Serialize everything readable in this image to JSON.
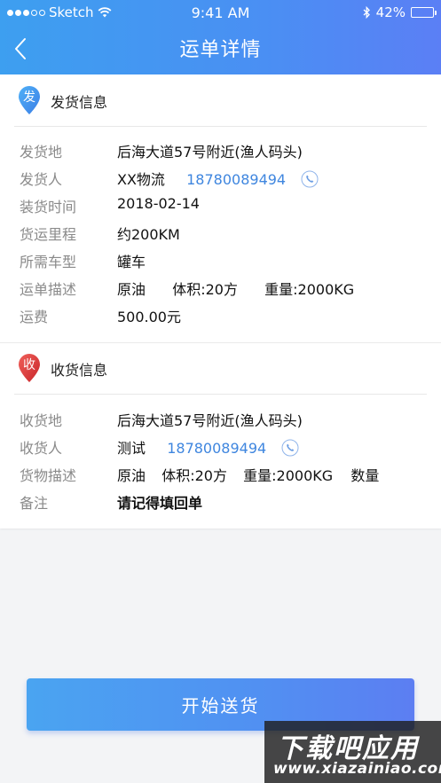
{
  "status_bar": {
    "carrier": "Sketch",
    "time": "9:41 AM",
    "battery": "42%",
    "battery_level": 0.42
  },
  "nav": {
    "title": "运单详情"
  },
  "shipping": {
    "badge": "发",
    "title": "发货信息",
    "rows": {
      "origin": {
        "label": "发货地",
        "value": "后海大道57号附近(渔人码头)"
      },
      "shipper": {
        "label": "发货人",
        "name": "XX物流",
        "phone": "18780089494"
      },
      "load_time": {
        "label": "装货时间",
        "value": "2018-02-14"
      },
      "distance": {
        "label": "货运里程",
        "value": "约200KM"
      },
      "vehicle": {
        "label": "所需车型",
        "value": "罐车"
      },
      "description": {
        "label": "运单描述",
        "cargo": "原油",
        "volume": "体积:20方",
        "weight": "重量:2000KG"
      },
      "fee": {
        "label": "运费",
        "value": "500.00元"
      }
    }
  },
  "receiving": {
    "badge": "收",
    "title": "收货信息",
    "rows": {
      "destination": {
        "label": "收货地",
        "value": "后海大道57号附近(渔人码头)"
      },
      "receiver": {
        "label": "收货人",
        "name": "测试",
        "phone": "18780089494"
      },
      "goods": {
        "label": "货物描述",
        "cargo": "原油",
        "volume": "体积:20方",
        "weight": "重量:2000KG",
        "quantity": "数量"
      },
      "remark": {
        "label": "备注",
        "value": "请记得填回单"
      }
    }
  },
  "actions": {
    "start_delivery": "开始送货"
  },
  "watermark": {
    "title": "下载吧应用",
    "url": "www.xiazainiao.com"
  },
  "colors": {
    "accent_blue": "#4a8ff3",
    "phone_blue": "#3f86df",
    "alert_red": "#d9382d",
    "fee_orange": "#f0a024"
  }
}
